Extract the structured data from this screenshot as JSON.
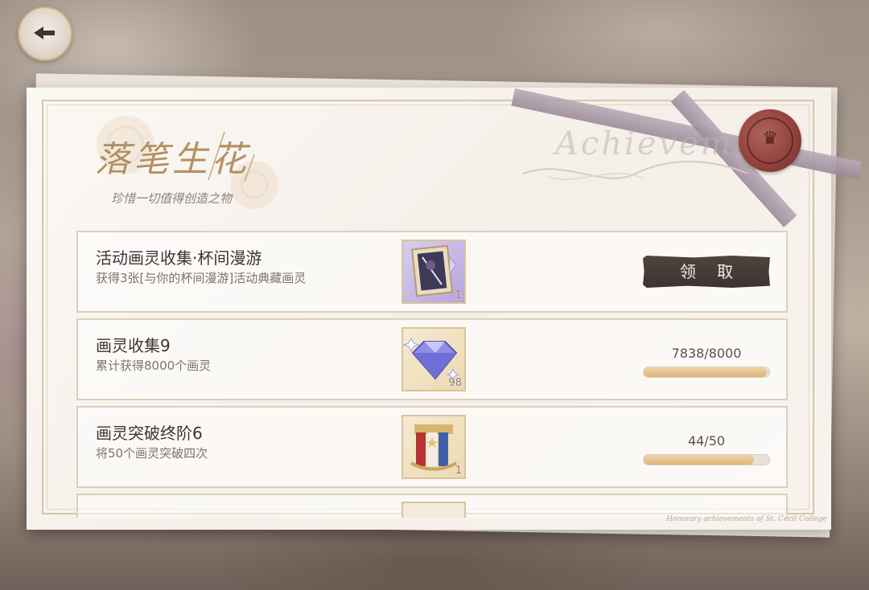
{
  "header": {
    "title": "落笔生花",
    "subtitle": "珍惜一切值得创造之物",
    "watermark": "Achieveme",
    "footer_text": "Honorary achievements of St. Cecil College",
    "seal_glyph": "♛"
  },
  "achievements": [
    {
      "title": "活动画灵收集·杯间漫游",
      "description": "获得3张[与你的杯间漫游]活动典藏画灵",
      "reward_icon": "card-icon",
      "reward_qty": "1",
      "status": "claim",
      "claim_label": "领 取"
    },
    {
      "title": "画灵收集9",
      "description": "累计获得8000个画灵",
      "reward_icon": "crystal-icon",
      "reward_qty": "98",
      "status": "progress",
      "progress_text": "7838/8000",
      "progress_fraction": 0.98
    },
    {
      "title": "画灵突破终阶6",
      "description": "将50个画灵突破四次",
      "reward_icon": "scroll-bundle-icon",
      "reward_qty": "1",
      "status": "progress",
      "progress_text": "44/50",
      "progress_fraction": 0.88
    }
  ],
  "colors": {
    "accent_gold": "#b39162",
    "claim_button": "#463a35",
    "progress_fill": "#deb57c",
    "seal_red": "#8c3e38"
  }
}
